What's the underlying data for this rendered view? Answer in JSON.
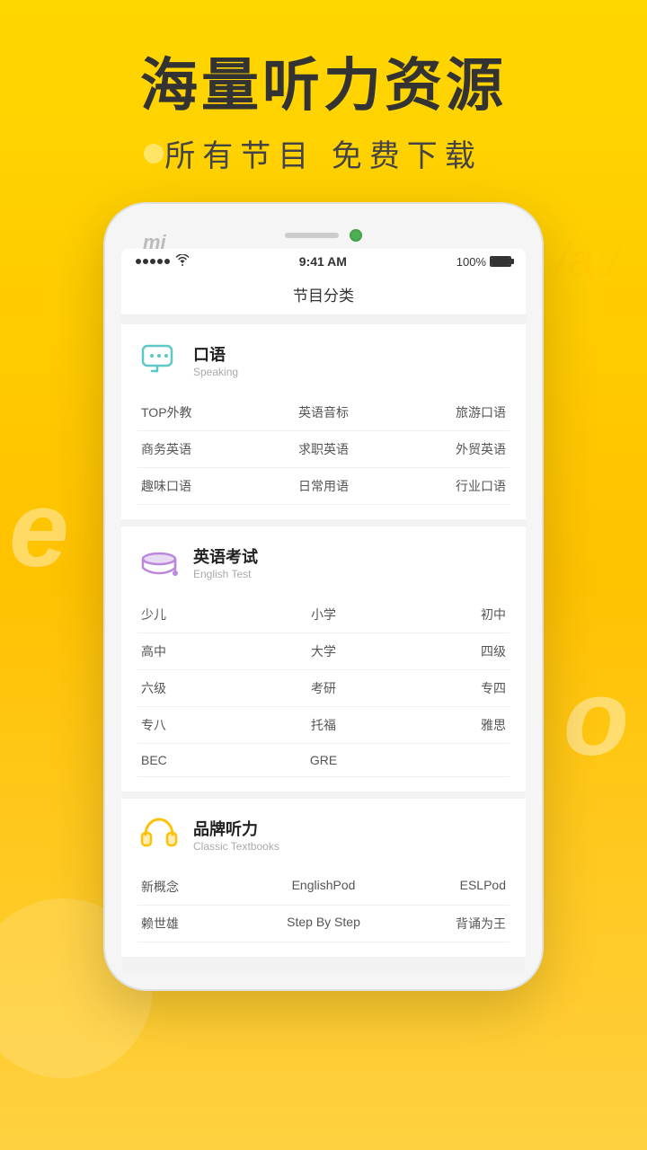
{
  "background": {
    "letters": [
      "e",
      "o"
    ],
    "phonetic": "/a:/",
    "gradient_start": "#FFD700",
    "gradient_end": "#FFC200"
  },
  "header": {
    "title": "海量听力资源",
    "subtitle": "所有节目  免费下载"
  },
  "phone": {
    "brand": "mi",
    "status_bar": {
      "time": "9:41 AM",
      "battery": "100%"
    },
    "nav_title": "节目分类",
    "categories": [
      {
        "id": "speaking",
        "name": "口语",
        "sub": "Speaking",
        "icon_type": "chat",
        "tags": [
          "TOP外教",
          "英语音标",
          "旅游口语",
          "商务英语",
          "求职英语",
          "外贸英语",
          "趣味口语",
          "日常用语",
          "行业口语"
        ]
      },
      {
        "id": "english-test",
        "name": "英语考试",
        "sub": "English Test",
        "icon_type": "cap",
        "tags": [
          "少儿",
          "小学",
          "初中",
          "高中",
          "大学",
          "四级",
          "六级",
          "考研",
          "专四",
          "专八",
          "托福",
          "雅思",
          "BEC",
          "GRE",
          ""
        ]
      },
      {
        "id": "classic",
        "name": "品牌听力",
        "sub": "Classic Textbooks",
        "icon_type": "headphone",
        "tags": [
          "新概念",
          "EnglishPod",
          "ESLPod",
          "赖世雄",
          "Step By Step",
          "背诵为王"
        ]
      }
    ]
  }
}
